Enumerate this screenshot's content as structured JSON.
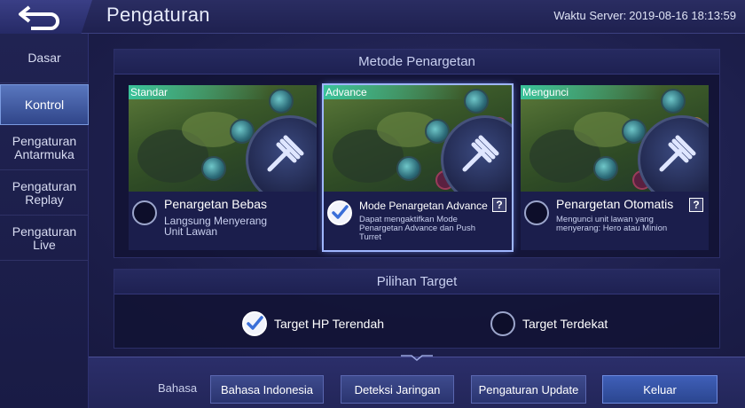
{
  "header": {
    "title": "Pengaturan",
    "server_time_label": "Waktu Server:",
    "server_time_value": "2019-08-16 18:13:59"
  },
  "sidebar": {
    "items": [
      {
        "label": "Dasar"
      },
      {
        "label": "Kontrol"
      },
      {
        "label": "Pengaturan Antarmuka"
      },
      {
        "label": "Pengaturan Replay"
      },
      {
        "label": "Pengaturan Live"
      }
    ],
    "active": "Kontrol"
  },
  "targeting": {
    "title": "Metode Penargetan",
    "modes": [
      {
        "tag": "Standar",
        "title": "Penargetan Bebas",
        "desc": "Langsung Menyerang Unit Lawan",
        "selected": false
      },
      {
        "tag": "Advance",
        "title": "Mode Penargetan Advance",
        "desc": "Dapat mengaktifkan Mode Penargetan Advance dan Push Turret",
        "selected": true,
        "help": "?"
      },
      {
        "tag": "Mengunci",
        "title": "Penargetan Otomatis",
        "desc": "Mengunci unit lawan yang menyerang: Hero atau Minion",
        "selected": false,
        "help": "?"
      }
    ]
  },
  "target_choice": {
    "title": "Pilihan Target",
    "options": [
      {
        "label": "Target HP Terendah",
        "checked": true
      },
      {
        "label": "Target Terdekat",
        "checked": false
      }
    ]
  },
  "footer": {
    "language_label": "Bahasa",
    "language_value": "Bahasa Indonesia",
    "network_button": "Deteksi Jaringan",
    "update_button": "Pengaturan Update",
    "exit_button": "Keluar"
  },
  "colors": {
    "accent": "#3ac29a",
    "selected_outline": "#9fb6ff",
    "background": "#1b1d45"
  }
}
